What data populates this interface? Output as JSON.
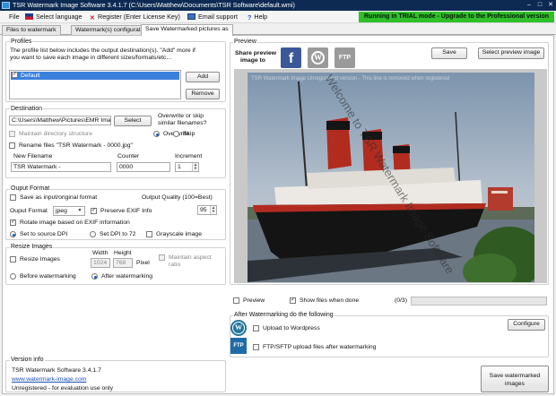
{
  "window": {
    "title": "TSR Watermark Image Software 3.4.1.7 (C:\\Users\\Matthew\\Documents\\TSR Software\\default.wmi)",
    "minimize": "–",
    "maximize": "□",
    "close": "✕"
  },
  "menu": {
    "file": "File",
    "language": "Select language",
    "register": "Register (Enter License Key)",
    "email": "Email support",
    "help": "Help",
    "trial": "Running in TRIAL mode - Upgrade to the Professional version"
  },
  "tabs": [
    "Files to watermark",
    "Watermark(s) configuration",
    "Save Watermarked pictures as"
  ],
  "profiles": {
    "label": "Profiles",
    "desc_line1": "The profile list below includes the output destination(s). \"Add\" more if",
    "desc_line2": "you want to save each image in different sizes/formats/etc...",
    "items": [
      "Default"
    ],
    "add": "Add",
    "remove": "Remove"
  },
  "destination": {
    "label": "Destination",
    "path": "C:\\Users\\Matthew\\Pictures\\EMR Ima",
    "select": "Select",
    "overwrite_q1": "Overwrite or skip",
    "overwrite_q2": "similar filenames?",
    "maintain": "Maintain directory structure",
    "overwrite": "Overwrite",
    "skip": "Skip",
    "rename": "Rename files \"TSR Watermark - 0000.jpg\"",
    "new_filename_label": "New Filename",
    "counter_label": "Counter",
    "increment_label": "Increment",
    "new_filename": "TSR Watermark -",
    "counter": "0000",
    "increment": "1"
  },
  "output_format": {
    "label": "Ouput Format",
    "save_as_input": "Save as input/original format",
    "quality_label": "Output Quality (100=Best)",
    "quality": "95",
    "format_label": "Ouput Format",
    "format": "jpeg",
    "preserve_exif": "Preserve EXIF Info",
    "rotate": "Rotate image based on EXIF information",
    "dpi_source": "Set to source DPI",
    "dpi_72": "Set DPI to 72",
    "grayscale": "Grayscale image"
  },
  "resize": {
    "label": "Resize Images",
    "resize_images": "Resize Images",
    "width_label": "Width",
    "height_label": "Height",
    "width": "1024",
    "height": "768",
    "pixel": "Pixel",
    "maintain1": "Maintain aspect",
    "maintain2": "ratio",
    "before": "Before watermarking",
    "after": "After watermarking"
  },
  "version": {
    "label": "Version info",
    "name": "TSR Watermark Software 3.4.1.7",
    "url": "www.watermark-image.com",
    "status": "Unregistered - for evaluation use only"
  },
  "preview": {
    "label": "Preview",
    "share1": "Share preview",
    "share2": "image to",
    "save": "Save",
    "select_preview": "Select preview image",
    "watermark_banner": "TSR Watermark Image Unregistered version - This line is removed when registered",
    "watermark_diag": "Welcome to TSR Watermark Image Software",
    "preview_cb": "Preview",
    "show_files": "Show files when done",
    "progress": "(0/3)"
  },
  "after": {
    "label": "After Watermarking do the following",
    "configure": "Configure",
    "wordpress": "Upload to Wordpress",
    "ftp": "FTP/SFTP upload files after watermarking",
    "ftp_icon": "FTP"
  },
  "save_button_l1": "Save watermarked",
  "save_button_l2": "images",
  "colors": {
    "titlebar": "#0d2a52",
    "trial_bg": "#2fc02a",
    "link": "#1a4fb8"
  }
}
